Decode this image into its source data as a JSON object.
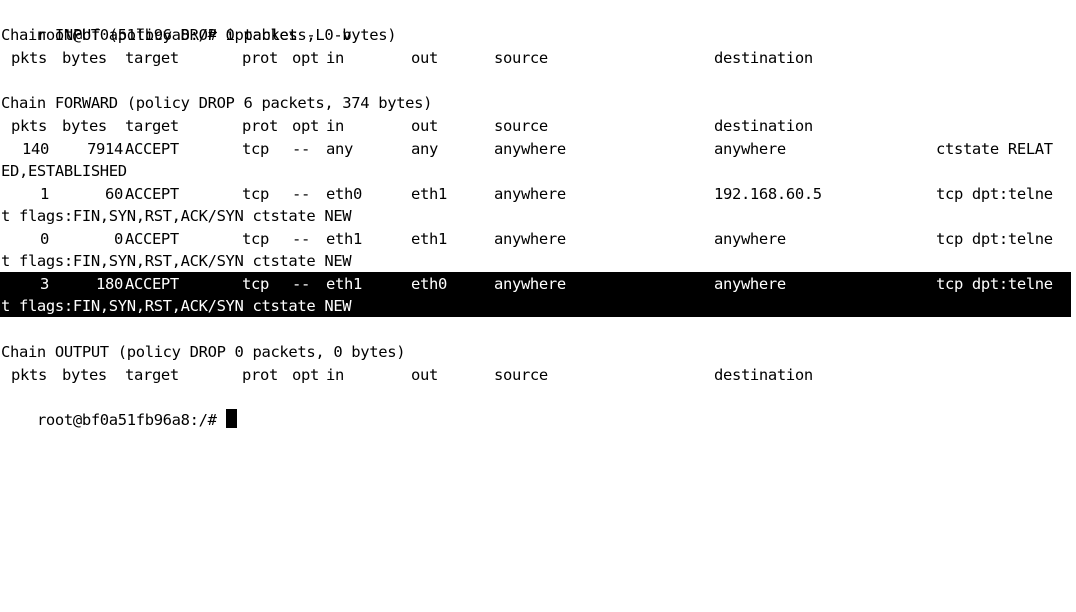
{
  "prompt": {
    "text": "root@bf0a51fb96a8:/#",
    "command": "iptables -L -v"
  },
  "chains": {
    "input": {
      "header": "Chain INPUT (policy DROP 0 packets, 0 bytes)"
    },
    "forward": {
      "header": "Chain FORWARD (policy DROP 6 packets, 374 bytes)"
    },
    "output": {
      "header": "Chain OUTPUT (policy DROP 0 packets, 0 bytes)"
    }
  },
  "columns": {
    "pkts": "pkts",
    "bytes": "bytes",
    "target": "target",
    "prot": "prot",
    "opt": "opt",
    "in": "in",
    "out": "out",
    "source": "source",
    "destination": "destination"
  },
  "forward_rules": [
    {
      "pkts": "140",
      "bytes": "7914",
      "target": "ACCEPT",
      "prot": "tcp",
      "opt": "--",
      "in": "any",
      "out": "any",
      "source": "anywhere",
      "destination": "anywhere",
      "extra": "ctstate RELAT",
      "wrap": "ED,ESTABLISHED",
      "highlighted": false
    },
    {
      "pkts": "1",
      "bytes": "60",
      "target": "ACCEPT",
      "prot": "tcp",
      "opt": "--",
      "in": "eth0",
      "out": "eth1",
      "source": "anywhere",
      "destination": "192.168.60.5",
      "extra": "tcp dpt:telne",
      "wrap": "t flags:FIN,SYN,RST,ACK/SYN ctstate NEW",
      "highlighted": false
    },
    {
      "pkts": "0",
      "bytes": "0",
      "target": "ACCEPT",
      "prot": "tcp",
      "opt": "--",
      "in": "eth1",
      "out": "eth1",
      "source": "anywhere",
      "destination": "anywhere",
      "extra": "tcp dpt:telne",
      "wrap": "t flags:FIN,SYN,RST,ACK/SYN ctstate NEW",
      "highlighted": false
    },
    {
      "pkts": "3",
      "bytes": "180",
      "target": "ACCEPT",
      "prot": "tcp",
      "opt": "--",
      "in": "eth1",
      "out": "eth0",
      "source": "anywhere",
      "destination": "anywhere",
      "extra": "tcp dpt:telne",
      "wrap": "t flags:FIN,SYN,RST,ACK/SYN ctstate NEW",
      "highlighted": true
    }
  ]
}
